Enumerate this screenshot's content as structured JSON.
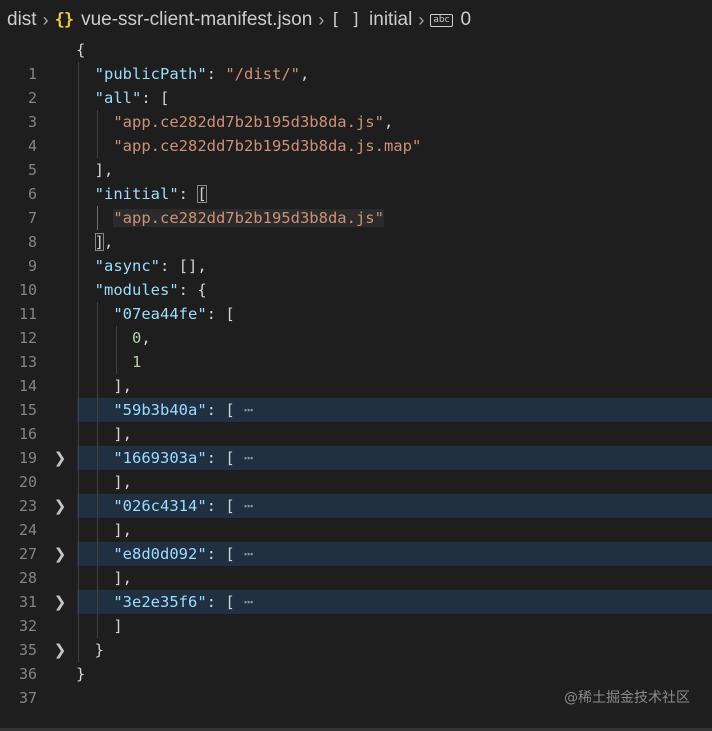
{
  "breadcrumb": {
    "folder": "dist",
    "file_icon": "{}",
    "file": "vue-ssr-client-manifest.json",
    "array_icon": "[ ]",
    "key": "initial",
    "string_icon": "abc",
    "index": "0"
  },
  "lines": [
    {
      "num": "1"
    },
    {
      "num": "2",
      "key": "\"publicPath\"",
      "value": "\"/dist/\""
    },
    {
      "num": "3",
      "key": "\"all\""
    },
    {
      "num": "4",
      "str": "\"app.ce282dd7b2b195d3b8da.js\""
    },
    {
      "num": "5",
      "str": "\"app.ce282dd7b2b195d3b8da.js.map\""
    },
    {
      "num": "6"
    },
    {
      "num": "7",
      "key": "\"initial\""
    },
    {
      "num": "8",
      "str": "\"app.ce282dd7b2b195d3b8da.js\""
    },
    {
      "num": "9"
    },
    {
      "num": "10",
      "key": "\"async\""
    },
    {
      "num": "11",
      "key": "\"modules\""
    },
    {
      "num": "12",
      "key": "\"07ea44fe\""
    },
    {
      "num": "13",
      "num_value": "0"
    },
    {
      "num": "14",
      "num_value": "1"
    },
    {
      "num": "15"
    },
    {
      "num": "16",
      "key": "\"59b3b40a\""
    },
    {
      "num": "19"
    },
    {
      "num": "20",
      "key": "\"1669303a\""
    },
    {
      "num": "23"
    },
    {
      "num": "24",
      "key": "\"026c4314\""
    },
    {
      "num": "27"
    },
    {
      "num": "28",
      "key": "\"e8d0d092\""
    },
    {
      "num": "31"
    },
    {
      "num": "32",
      "key": "\"3e2e35f6\""
    },
    {
      "num": "35"
    },
    {
      "num": "36"
    },
    {
      "num": "37"
    }
  ],
  "ellipsis": "⋯",
  "fold_icon": "chevron-right-icon",
  "watermark": "@稀土掘金技术社区",
  "colors": {
    "background": "#1e1e1e",
    "key": "#9cdcfe",
    "string": "#ce9178",
    "number": "#b5cea8",
    "folded_line": "#203040"
  }
}
